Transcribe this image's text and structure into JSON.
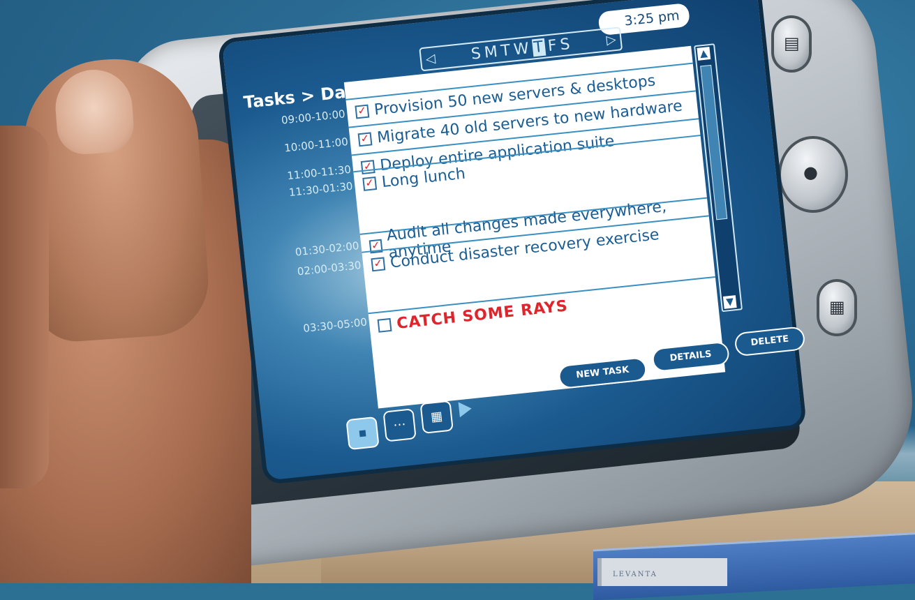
{
  "screen": {
    "clock": "3:25 pm",
    "title": "Tasks > Daily",
    "week_nav": {
      "prev_icon": "triangle-left-icon",
      "next_icon": "triangle-right-icon",
      "days": [
        "S",
        "M",
        "T",
        "W",
        "T",
        "F",
        "S"
      ],
      "selected_index": 4
    },
    "times": [
      "09:00-10:00",
      "10:00-11:00",
      "11:00-11:30",
      "11:30-01:30",
      "01:30-02:00",
      "02:00-03:30",
      "03:30-05:00"
    ],
    "tasks": [
      {
        "label": "Provision 50 new servers & desktops",
        "checked": true
      },
      {
        "label": "Migrate 40 old servers to new hardware",
        "checked": true
      },
      {
        "label": "Deploy entire application suite",
        "checked": true
      },
      {
        "label": "Long lunch",
        "checked": true
      },
      {
        "label": "Audit all changes made everywhere, anytime",
        "checked": true
      },
      {
        "label": "Conduct disaster recovery exercise",
        "checked": true
      },
      {
        "label": "CATCH SOME RAYS",
        "checked": false
      }
    ],
    "buttons": {
      "new_task": "NEW TASK",
      "details": "DETAILS",
      "delete": "DELETE"
    },
    "view_buttons": [
      "day-view-icon",
      "week-view-icon",
      "month-view-icon",
      "next-arrow-icon"
    ],
    "scrollbar": {
      "up_icon": "scroll-up-icon",
      "down_icon": "scroll-down-icon"
    }
  },
  "hardware": {
    "server_brand": "LEVANTA"
  },
  "colors": {
    "accent": "#1b5a8f",
    "task_text": "#1a5d94",
    "highlight_red": "#e0242b",
    "banner_green": "#7dbb43"
  }
}
